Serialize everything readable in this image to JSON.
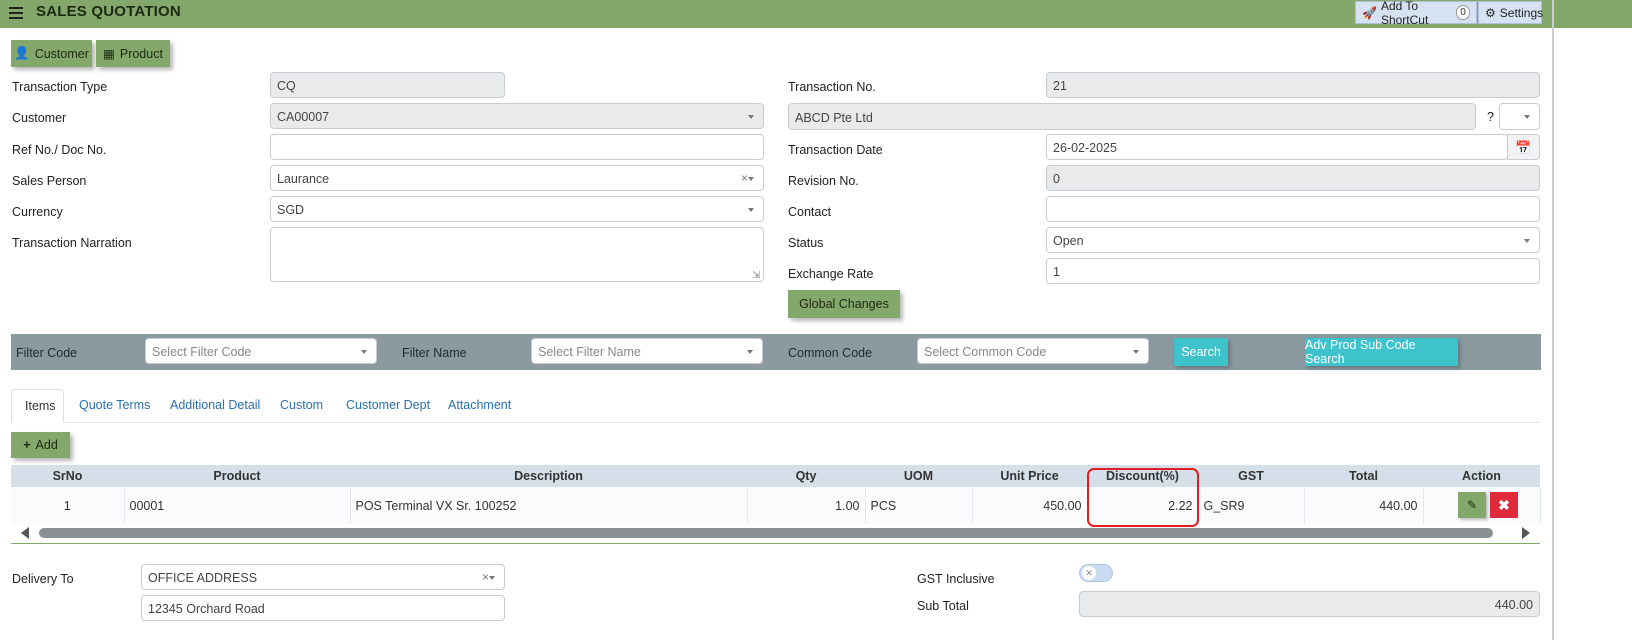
{
  "header": {
    "title": "SALES QUOTATION",
    "shortcut_label": "Add To ShortCut",
    "shortcut_count": "0",
    "settings_label": "Settings"
  },
  "toolbar": {
    "customer_label": "Customer",
    "product_label": "Product"
  },
  "form_left": {
    "transaction_type_label": "Transaction Type",
    "transaction_type_value": "CQ",
    "customer_label": "Customer",
    "customer_value": "CA00007",
    "ref_label": "Ref No./ Doc No.",
    "ref_value": "",
    "sales_person_label": "Sales Person",
    "sales_person_value": "Laurance",
    "currency_label": "Currency",
    "currency_value": "SGD",
    "narration_label": "Transaction Narration",
    "narration_value": ""
  },
  "form_right": {
    "transaction_no_label": "Transaction No.",
    "transaction_no_value": "21",
    "customer_name_value": "ABCD Pte Ltd",
    "question_mark": "?",
    "transaction_date_label": "Transaction Date",
    "transaction_date_value": "26-02-2025",
    "revision_label": "Revision No.",
    "revision_value": "0",
    "contact_label": "Contact",
    "contact_value": "",
    "status_label": "Status",
    "status_value": "Open",
    "exchange_rate_label": "Exchange Rate",
    "exchange_rate_value": "1",
    "global_changes_label": "Global Changes"
  },
  "filter": {
    "code_label": "Filter Code",
    "code_placeholder": "Select Filter Code",
    "name_label": "Filter Name",
    "name_placeholder": "Select Filter Name",
    "common_label": "Common Code",
    "common_placeholder": "Select Common Code",
    "search_label": "Search",
    "adv_label": "Adv Prod Sub Code Search"
  },
  "tabs": [
    "Items",
    "Quote Terms",
    "Additional Detail",
    "Custom",
    "Customer Dept",
    "Attachment"
  ],
  "add_label": "Add",
  "table": {
    "headers": [
      "SrNo",
      "Product",
      "Description",
      "Qty",
      "UOM",
      "Unit Price",
      "Discount(%)",
      "GST",
      "Total",
      "Action"
    ],
    "row": {
      "srno": "1",
      "product": "00001",
      "description": "POS Terminal VX Sr. 100252",
      "qty": "1.00",
      "uom": "PCS",
      "unit_price": "450.00",
      "discount": "2.22",
      "gst": "G_SR9",
      "total": "440.00"
    }
  },
  "bottom": {
    "delivery_label": "Delivery To",
    "delivery_value": "OFFICE ADDRESS",
    "address_line": "12345 Orchard Road",
    "gst_inclusive_label": "GST Inclusive",
    "subtotal_label": "Sub Total",
    "subtotal_value": "440.00"
  },
  "colors": {
    "header_bg": "#84a86c",
    "filter_bg": "#8b9aa0",
    "teal_button": "#3ec2cc",
    "highlight": "#e02020"
  }
}
